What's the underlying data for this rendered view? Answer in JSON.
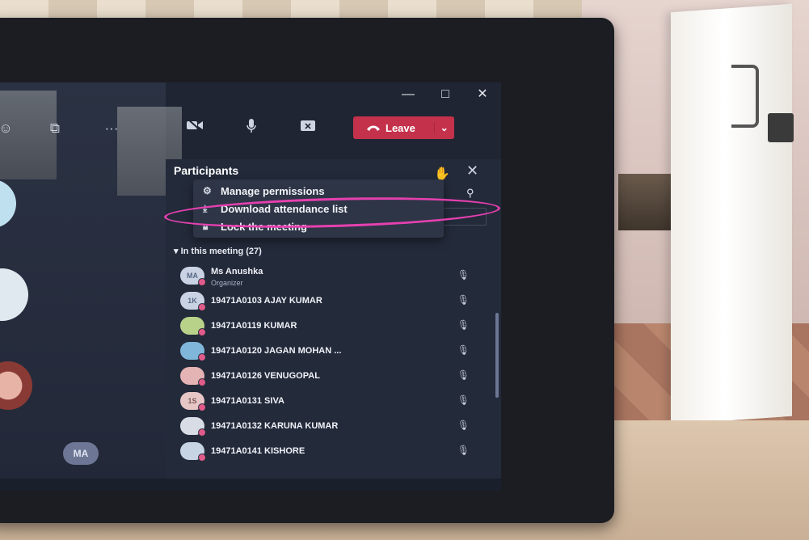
{
  "window": {
    "minimize_glyph": "—",
    "maximize_glyph": "□",
    "close_glyph": "✕"
  },
  "toolbar": {
    "more_glyph": "···",
    "leave_label": "Leave",
    "leave_caret": "⌄",
    "leave_color": "#c4314b"
  },
  "self_tile": {
    "initials": "MA"
  },
  "participants_pane": {
    "title": "Participants",
    "close_glyph": "✕",
    "menu": [
      {
        "icon": "gear-icon",
        "label": "Manage permissions"
      },
      {
        "icon": "download-icon",
        "label": "Download attendance list"
      },
      {
        "icon": "lock-icon",
        "label": "Lock the meeting"
      }
    ],
    "section_label": "In this meeting (27)",
    "participants": [
      {
        "initials": "MA",
        "name": "Ms Anushka",
        "role": "Organizer"
      },
      {
        "initials": "1K",
        "name": "19471A0103 AJAY KUMAR",
        "role": ""
      },
      {
        "initials": "",
        "name": "19471A0119 KUMAR",
        "role": ""
      },
      {
        "initials": "",
        "name": "19471A0120 JAGAN MOHAN ...",
        "role": ""
      },
      {
        "initials": "",
        "name": "19471A0126 VENUGOPAL",
        "role": ""
      },
      {
        "initials": "1S",
        "name": "19471A0131 SIVA",
        "role": ""
      },
      {
        "initials": "",
        "name": "19471A0132 KARUNA KUMAR",
        "role": ""
      },
      {
        "initials": "",
        "name": "19471A0141 KISHORE",
        "role": ""
      }
    ],
    "highlight_color": "#e640b0"
  }
}
